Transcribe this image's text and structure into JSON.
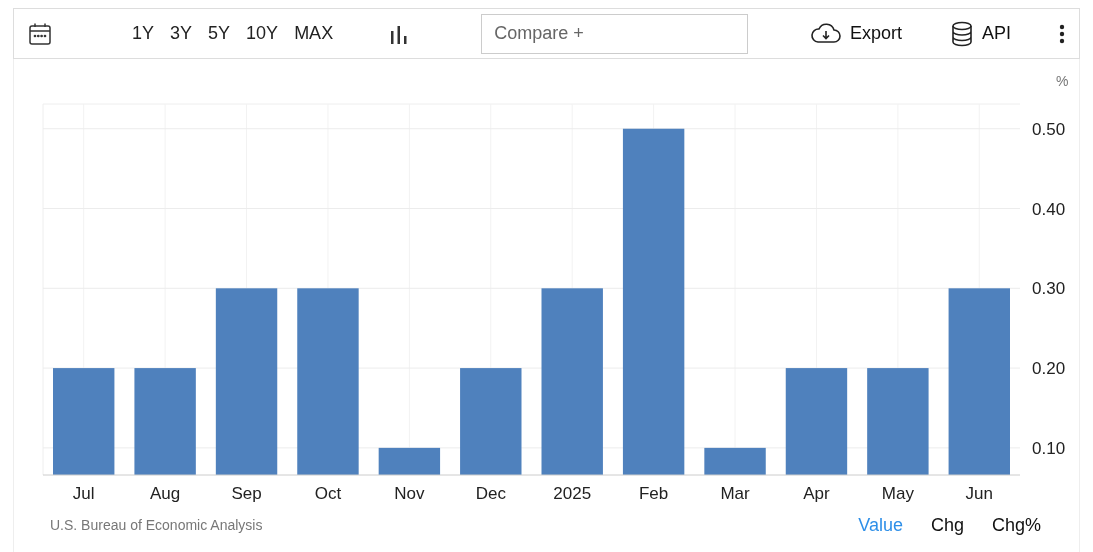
{
  "toolbar": {
    "ranges": [
      {
        "label": "1Y"
      },
      {
        "label": "3Y"
      },
      {
        "label": "5Y"
      },
      {
        "label": "10Y"
      },
      {
        "label": "MAX"
      }
    ],
    "compare": {
      "placeholder": "Compare +"
    },
    "export": "Export",
    "api": "API"
  },
  "chart": {
    "unit": "%",
    "chart_data": {
      "type": "bar",
      "categories": [
        "Jul",
        "Aug",
        "Sep",
        "Oct",
        "Nov",
        "Dec",
        "2025",
        "Feb",
        "Mar",
        "Apr",
        "May",
        "Jun"
      ],
      "grid": true,
      "series": [
        {
          "color": "#4f81bd",
          "values": [
            0.2,
            0.2,
            0.3,
            0.3,
            0.1,
            0.2,
            0.3,
            0.5,
            0.1,
            0.2,
            0.2,
            0.3
          ]
        }
      ],
      "ylim": [
        0.066,
        0.531
      ],
      "yticks": [
        {
          "value": 0.1,
          "label": "0.10"
        },
        {
          "value": 0.2,
          "label": "0.20"
        },
        {
          "value": 0.3,
          "label": "0.30"
        },
        {
          "value": 0.4,
          "label": "0.40"
        },
        {
          "value": 0.5,
          "label": "0.50"
        }
      ]
    }
  },
  "footer": {
    "source": "U.S. Bureau of Economic Analysis",
    "views": [
      {
        "label": "Value",
        "selected": true
      },
      {
        "label": "Chg",
        "selected": false
      },
      {
        "label": "Chg%",
        "selected": false
      }
    ]
  }
}
